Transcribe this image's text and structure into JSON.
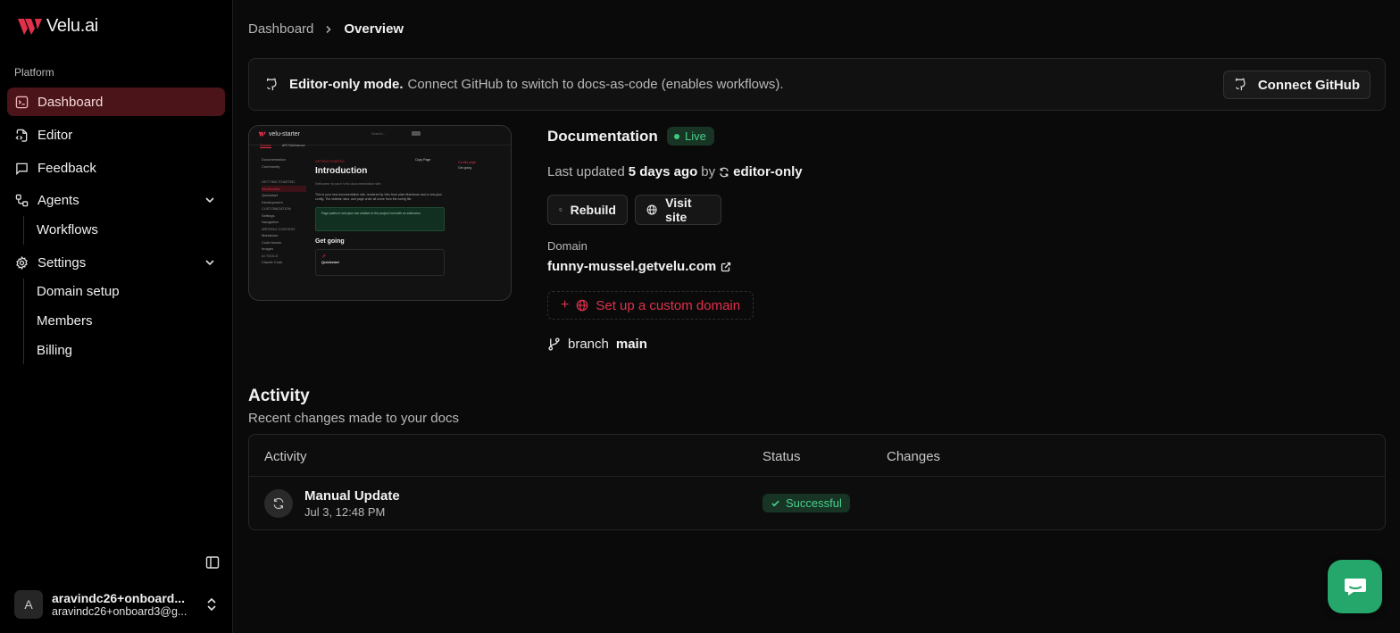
{
  "app": {
    "logo_text": "Velu.ai",
    "accent": "#e0304a"
  },
  "sidebar": {
    "section_label": "Platform",
    "items": [
      {
        "label": "Dashboard",
        "icon": "terminal-square-icon",
        "active": true
      },
      {
        "label": "Editor",
        "icon": "file-code-icon"
      },
      {
        "label": "Feedback",
        "icon": "message-square-icon"
      },
      {
        "label": "Agents",
        "icon": "workflow-icon",
        "expanded": true
      },
      {
        "label": "Settings",
        "icon": "gear-icon",
        "expanded": true
      }
    ],
    "agents_sub": [
      "Workflows"
    ],
    "settings_sub": [
      "Domain setup",
      "Members",
      "Billing"
    ],
    "user": {
      "initial": "A",
      "name": "aravindc26+onboard...",
      "email": "aravindc26+onboard3@g..."
    }
  },
  "breadcrumb": {
    "parent": "Dashboard",
    "current": "Overview"
  },
  "banner": {
    "strong": "Editor-only mode.",
    "text": "Connect GitHub to switch to docs-as-code (enables workflows).",
    "button": "Connect GitHub"
  },
  "preview": {
    "site_name": "velu-starter",
    "search": "Search...",
    "tabs": [
      "Guides",
      "API Reference"
    ],
    "sidebar_lines": [
      "Documentation",
      "Community",
      "",
      "GETTING STARTED",
      "Introduction",
      "Quickstart",
      "Development",
      "",
      "CUSTOMIZATION",
      "Settings",
      "Navigation",
      "",
      "WRITING CONTENT",
      "Markdown",
      "Code blocks",
      "Images",
      "",
      "AI TOOLS",
      "Claude Code"
    ],
    "kicker": "GETTING STARTED",
    "title": "Introduction",
    "subtitle": "Welcome to your Velu documentation site.",
    "paragraph": "This is your new documentation site, rendered by Velu from plain Markdown and a velu.json config. The sidebar, tabs, and page order all come from the config file.",
    "note": "Page paths in velu.json are relative to the project root with no extension.",
    "h2": "Get going",
    "card_title": "Quickstart",
    "copy_page": "Copy Page",
    "on_this_page": "On this page",
    "toc_item": "Get going"
  },
  "documentation": {
    "title": "Documentation",
    "status": "Live",
    "last_updated_prefix": "Last updated",
    "last_updated_value": "5 days ago",
    "by_label": "by",
    "by_value": "editor-only",
    "rebuild_button": "Rebuild",
    "visit_button": "Visit site",
    "domain_label": "Domain",
    "domain_value": "funny-mussel.getvelu.com",
    "custom_domain_button": "Set up a custom domain",
    "branch_label": "branch",
    "branch_value": "main"
  },
  "activity": {
    "title": "Activity",
    "subtitle": "Recent changes made to your docs",
    "columns": [
      "Activity",
      "Status",
      "Changes"
    ],
    "rows": [
      {
        "title": "Manual Update",
        "date": "Jul 3, 12:48 PM",
        "status": "Successful",
        "changes": ""
      }
    ]
  }
}
